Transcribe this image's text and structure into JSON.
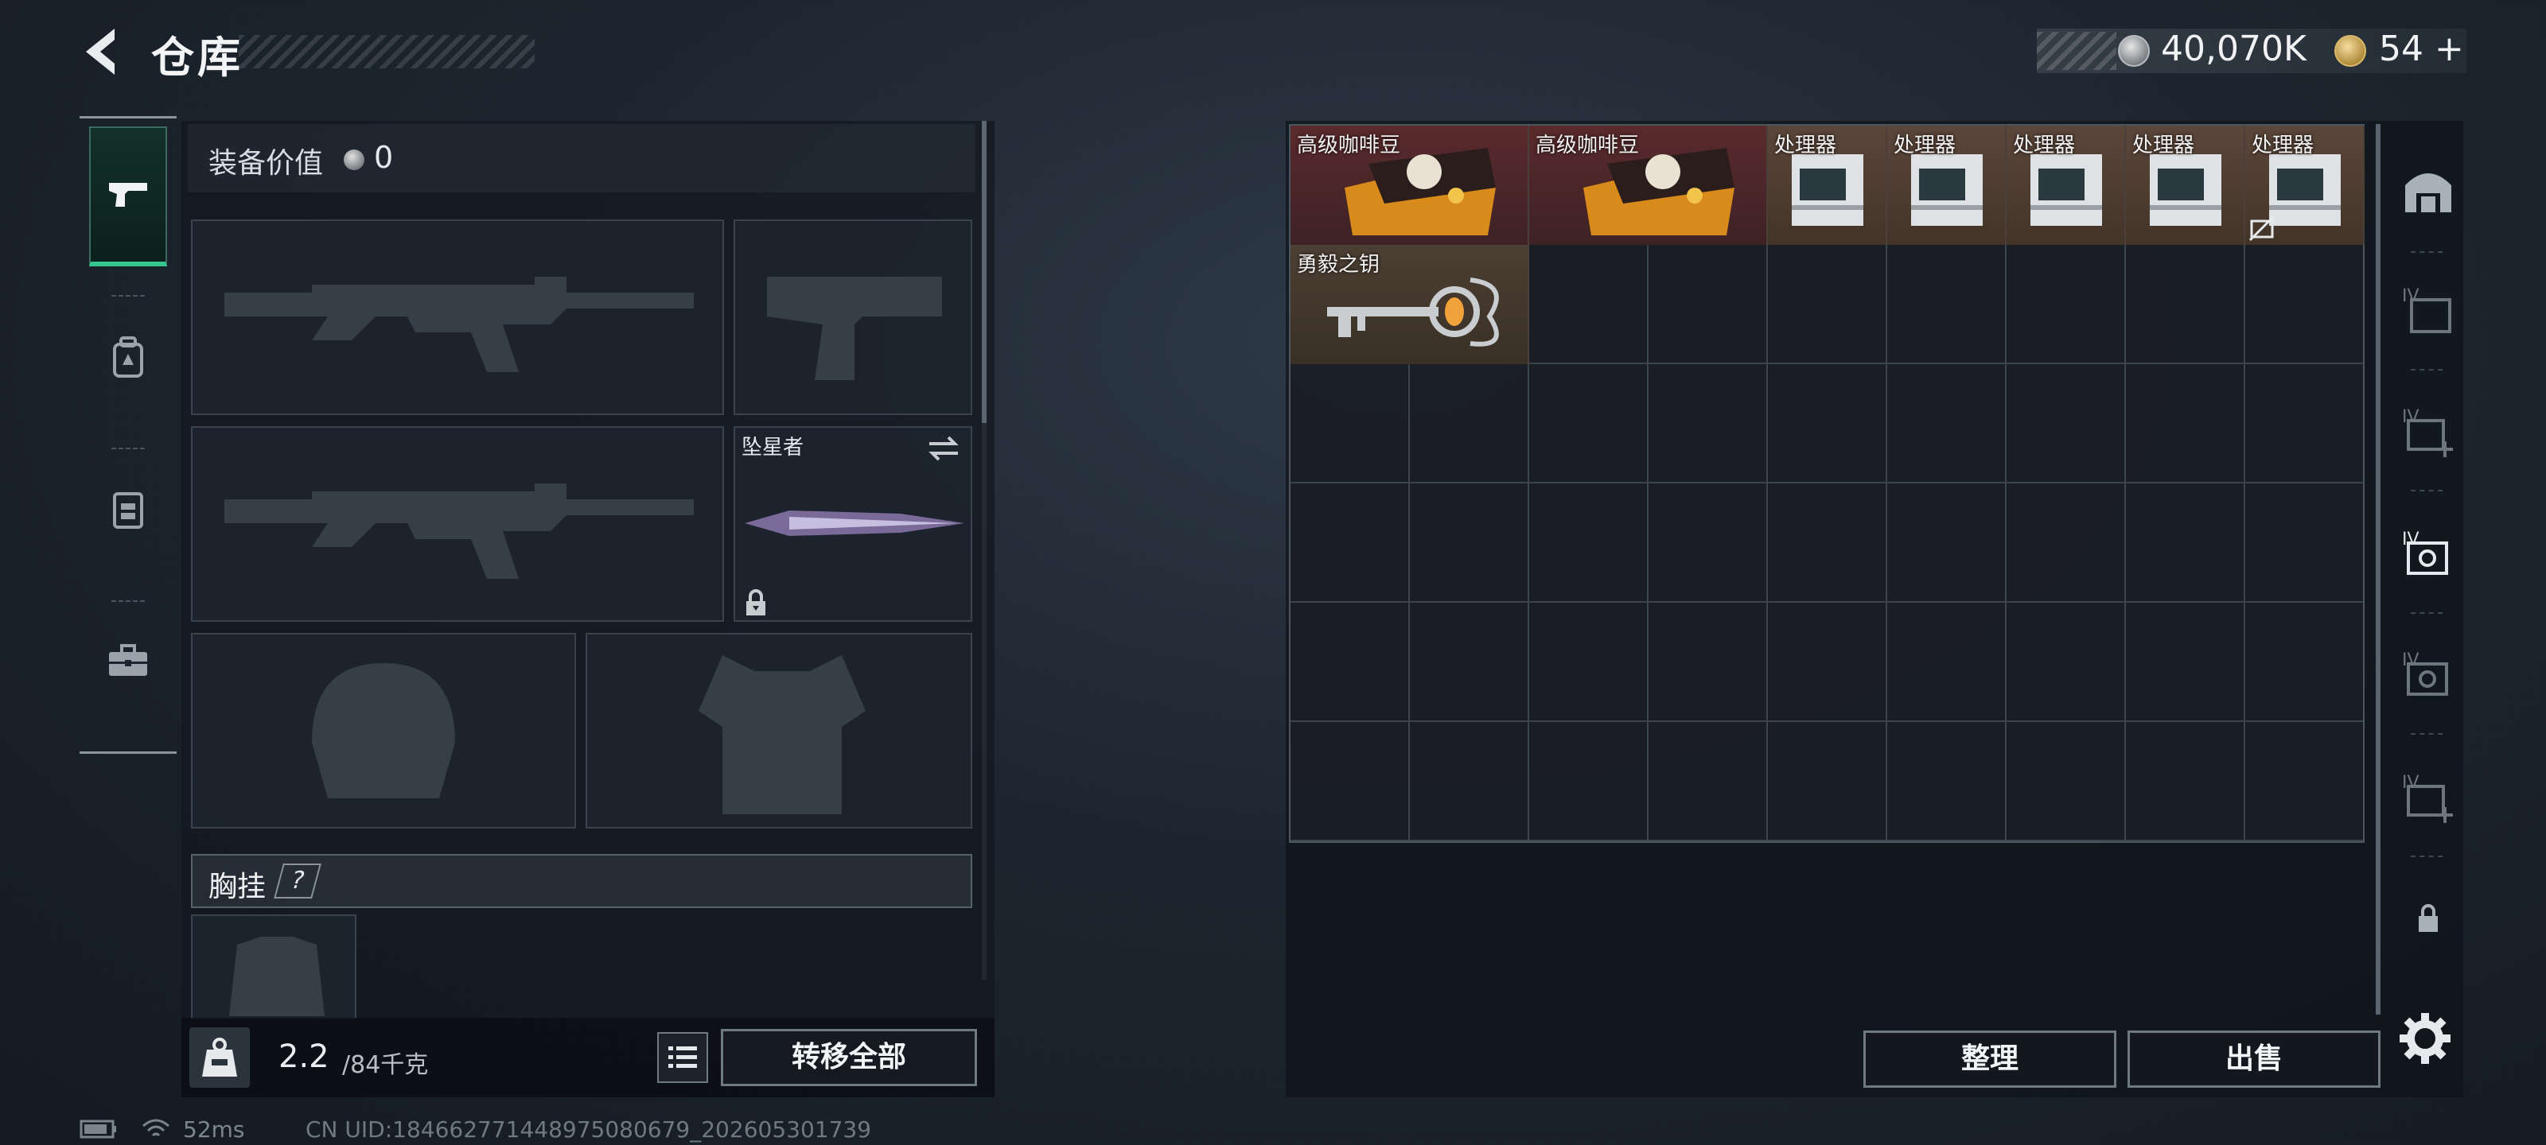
{
  "header": {
    "title": "仓库",
    "money": "40,070K",
    "gold": "54",
    "gold_plus": "+"
  },
  "left_nav": {
    "items": [
      {
        "icon": "pistol-icon",
        "active": true
      },
      {
        "icon": "backpack-icon",
        "active": false
      },
      {
        "icon": "vest-icon",
        "active": false
      },
      {
        "icon": "toolbox-icon",
        "active": false
      }
    ]
  },
  "loadout": {
    "value_label": "装备价值",
    "value": "0",
    "melee_name": "坠星者",
    "chest_label": "胸挂",
    "chest_help": "?",
    "weight_value": "2.2",
    "weight_limit": "/84千克",
    "transfer_all": "转移全部"
  },
  "storage": {
    "items": [
      {
        "name": "高级咖啡豆",
        "type": "coffee"
      },
      {
        "name": "高级咖啡豆",
        "type": "coffee"
      },
      {
        "name": "处理器",
        "type": "cpu"
      },
      {
        "name": "处理器",
        "type": "cpu"
      },
      {
        "name": "处理器",
        "type": "cpu"
      },
      {
        "name": "处理器",
        "type": "cpu"
      },
      {
        "name": "处理器",
        "type": "cpu"
      },
      {
        "name": "勇毅之钥",
        "type": "key"
      }
    ],
    "sort_label": "整理",
    "sell_label": "出售"
  },
  "status": {
    "ping": "52ms",
    "uid": "CN UID:184662771448975080679_202605301739"
  },
  "colors": {
    "accent_green": "#35c58d",
    "coffee_bg": "#5a2a2c",
    "cpu_bg": "#5b463a"
  }
}
